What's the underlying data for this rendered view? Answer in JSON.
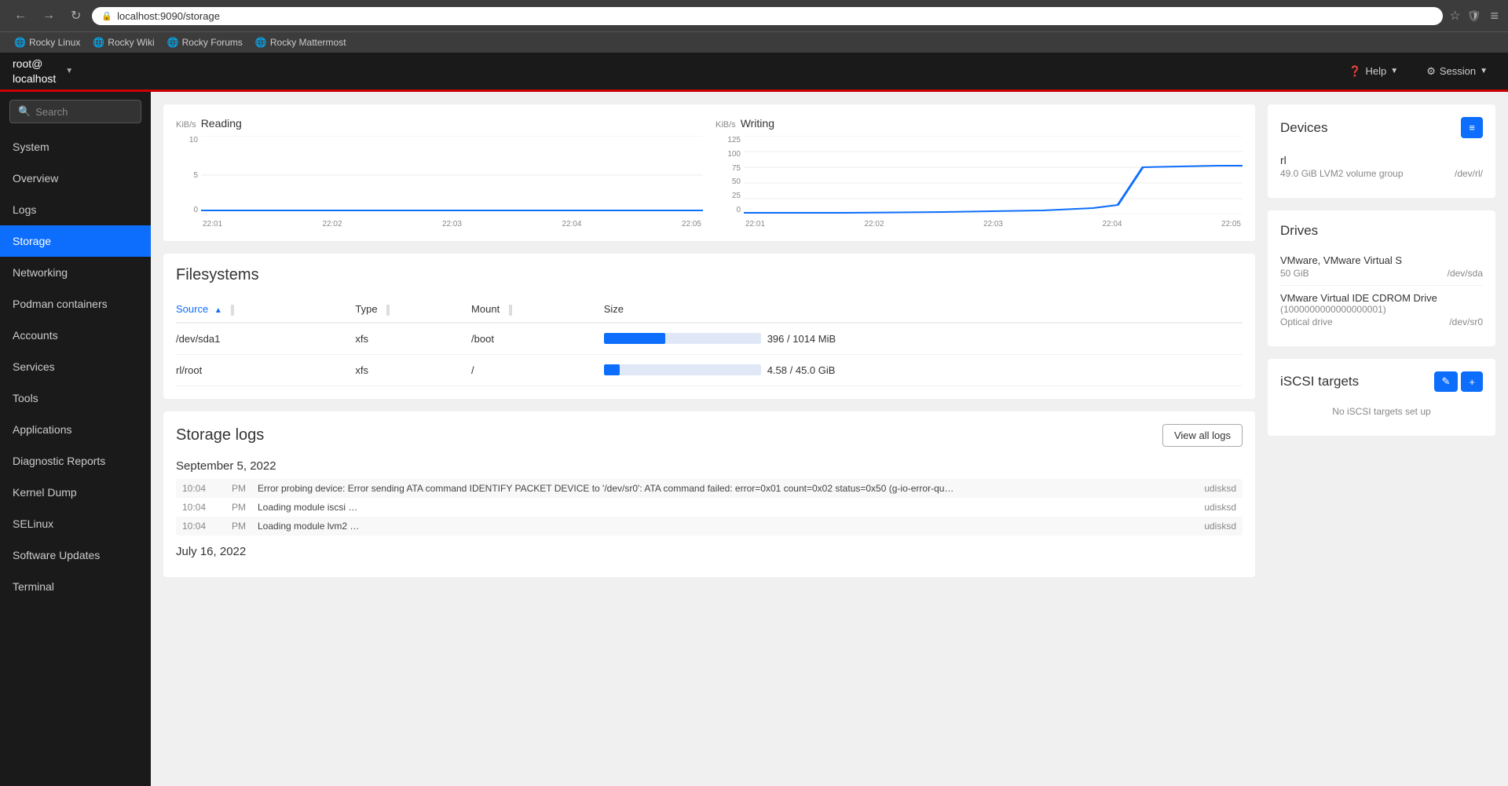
{
  "browser": {
    "back_btn": "←",
    "forward_btn": "→",
    "reload_btn": "↻",
    "address": "localhost:9090/storage",
    "shield_icon": "🛡",
    "menu_icon": "≡",
    "bookmarks": [
      {
        "label": "Rocky Linux"
      },
      {
        "label": "Rocky Wiki"
      },
      {
        "label": "Rocky Forums"
      },
      {
        "label": "Rocky Mattermost"
      }
    ]
  },
  "app_header": {
    "user": "root@",
    "hostname": "localhost",
    "help_label": "Help",
    "session_label": "Session"
  },
  "sidebar": {
    "search_placeholder": "Search",
    "items": [
      {
        "label": "System",
        "id": "system"
      },
      {
        "label": "Overview",
        "id": "overview"
      },
      {
        "label": "Logs",
        "id": "logs"
      },
      {
        "label": "Storage",
        "id": "storage",
        "active": true
      },
      {
        "label": "Networking",
        "id": "networking"
      },
      {
        "label": "Podman containers",
        "id": "podman"
      },
      {
        "label": "Accounts",
        "id": "accounts"
      },
      {
        "label": "Services",
        "id": "services"
      },
      {
        "label": "Tools",
        "id": "tools"
      },
      {
        "label": "Applications",
        "id": "applications"
      },
      {
        "label": "Diagnostic Reports",
        "id": "diagnostic"
      },
      {
        "label": "Kernel Dump",
        "id": "kernel"
      },
      {
        "label": "SELinux",
        "id": "selinux"
      },
      {
        "label": "Software Updates",
        "id": "software"
      },
      {
        "label": "Terminal",
        "id": "terminal"
      }
    ]
  },
  "charts": {
    "reading": {
      "unit": "KiB/s",
      "title": "Reading",
      "y_labels": [
        "10",
        "5",
        "0"
      ],
      "x_labels": [
        "22:01",
        "22:02",
        "22:03",
        "22:04",
        "22:05"
      ]
    },
    "writing": {
      "unit": "KiB/s",
      "title": "Writing",
      "y_labels": [
        "125",
        "100",
        "75",
        "50",
        "25",
        "0"
      ],
      "x_labels": [
        "22:01",
        "22:02",
        "22:03",
        "22:04",
        "22:05"
      ]
    }
  },
  "filesystems": {
    "title": "Filesystems",
    "columns": {
      "source": "Source",
      "type": "Type",
      "mount": "Mount",
      "size": "Size"
    },
    "rows": [
      {
        "source": "/dev/sda1",
        "type": "xfs",
        "mount": "/boot",
        "size_label": "396 / 1014 MiB",
        "progress": 39
      },
      {
        "source": "rl/root",
        "type": "xfs",
        "mount": "/",
        "size_label": "4.58 / 45.0 GiB",
        "progress": 10
      }
    ]
  },
  "storage_logs": {
    "title": "Storage logs",
    "view_all_label": "View all logs",
    "dates": [
      {
        "date": "September 5, 2022",
        "entries": [
          {
            "time": "10:04",
            "level": "PM",
            "message": "Error probing device: Error sending ATA command IDENTIFY PACKET DEVICE to '/dev/sr0': ATA command failed: error=0x01 count=0x02 status=0x50 (g-io-error-qu…",
            "source": "udisksd"
          },
          {
            "time": "10:04",
            "level": "PM",
            "message": "Loading module iscsi …",
            "source": "udisksd"
          },
          {
            "time": "10:04",
            "level": "PM",
            "message": "Loading module lvm2 …",
            "source": "udisksd"
          }
        ]
      },
      {
        "date": "July 16, 2022",
        "entries": []
      }
    ]
  },
  "devices": {
    "title": "Devices",
    "list_btn": "≡",
    "items": [
      {
        "name": "rl",
        "description": "49.0 GiB LVM2 volume group",
        "path": "/dev/rl/"
      }
    ]
  },
  "drives": {
    "title": "Drives",
    "items": [
      {
        "name": "VMware, VMware Virtual S",
        "size": "50 GiB",
        "path": "/dev/sda"
      },
      {
        "name": "VMware Virtual IDE CDROM Drive",
        "detail": "(1000000000000000001)",
        "type": "Optical drive",
        "path": "/dev/sr0"
      }
    ]
  },
  "iscsi": {
    "title": "iSCSI targets",
    "edit_label": "✎",
    "add_label": "+",
    "empty_text": "No iSCSI targets set up"
  }
}
